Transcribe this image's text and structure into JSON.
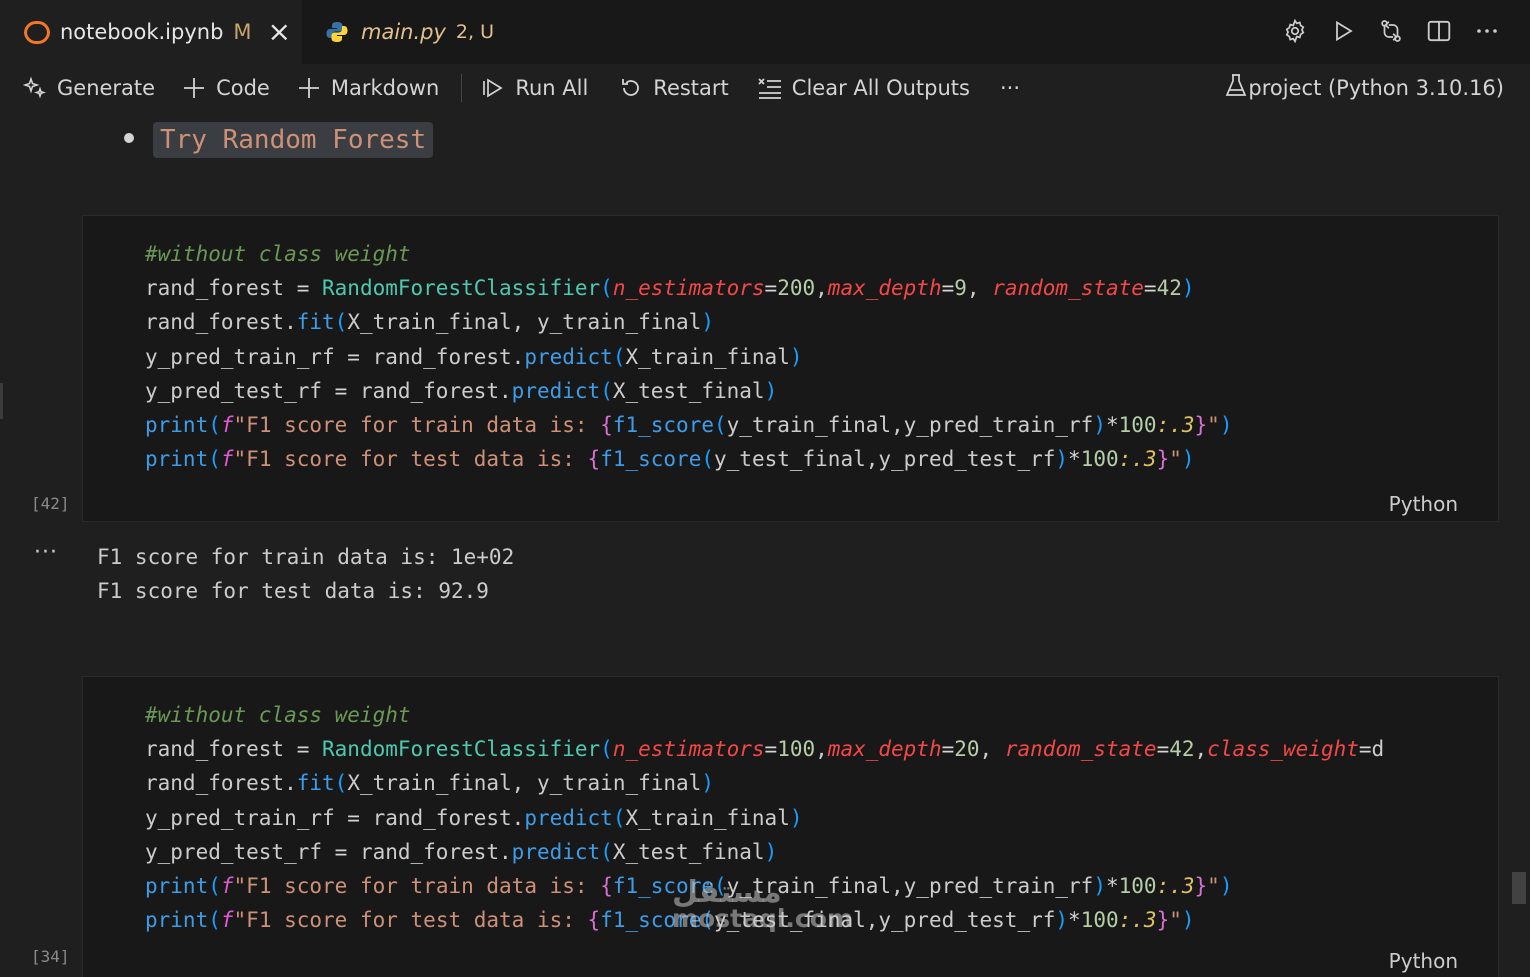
{
  "tabs": {
    "active": {
      "name": "notebook.ipynb",
      "status": "M"
    },
    "inactive": {
      "name": "main.py",
      "status": "2, U"
    }
  },
  "toolbar": {
    "generate": "Generate",
    "code": "Code",
    "markdown": "Markdown",
    "run_all": "Run All",
    "restart": "Restart",
    "clear_outputs": "Clear All Outputs",
    "more": "···",
    "kernel": "project (Python 3.10.16)"
  },
  "markdown_cell": {
    "text": "Try Random Forest"
  },
  "cell1": {
    "exec_count": "[42]",
    "language": "Python",
    "comment": "#without class weight",
    "params": {
      "n_estimators": "200",
      "max_depth": "9",
      "random_state": "42"
    },
    "output": [
      "F1 score for train data is: 1e+02",
      "F1 score for test data is: 92.9"
    ]
  },
  "cell2": {
    "exec_count": "[34]",
    "language": "Python",
    "comment": "#without class weight",
    "params": {
      "n_estimators": "100",
      "max_depth": "20",
      "random_state": "42"
    }
  },
  "watermark": {
    "line1": "مستقل",
    "line2": "mostaql.com"
  },
  "colors": {
    "background": "#1f1f1f",
    "cell_bg": "#181818",
    "jupyter_orange": "#f37726",
    "modified": "#e2c08d"
  }
}
